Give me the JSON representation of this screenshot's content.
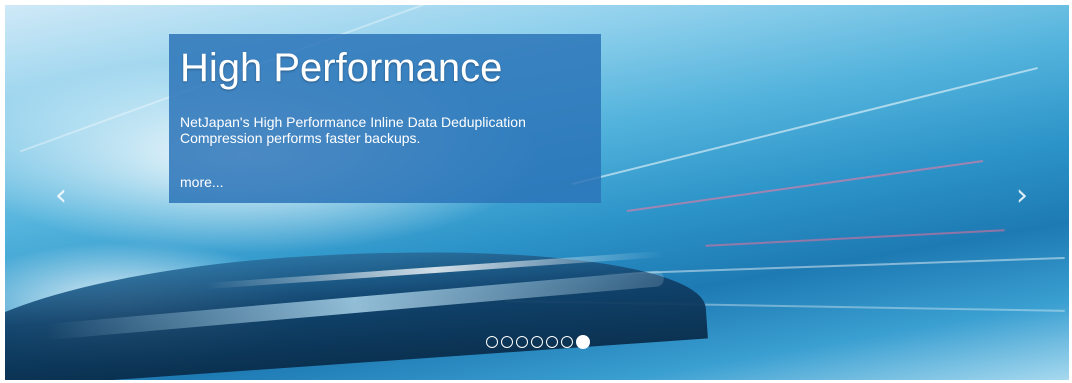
{
  "slide": {
    "title": "High Performance",
    "text": "NetJapan's High Performance Inline Data Deduplication Compression performs faster backups.",
    "more_label": "more..."
  },
  "navigation": {
    "prev_icon": "chevron-left-icon",
    "next_icon": "chevron-right-icon",
    "prev_glyph": "‹",
    "next_glyph": "›"
  },
  "pagination": {
    "total": 7,
    "active_index": 6
  },
  "colors": {
    "caption_bg": "#2b74b8",
    "text": "#ffffff"
  }
}
